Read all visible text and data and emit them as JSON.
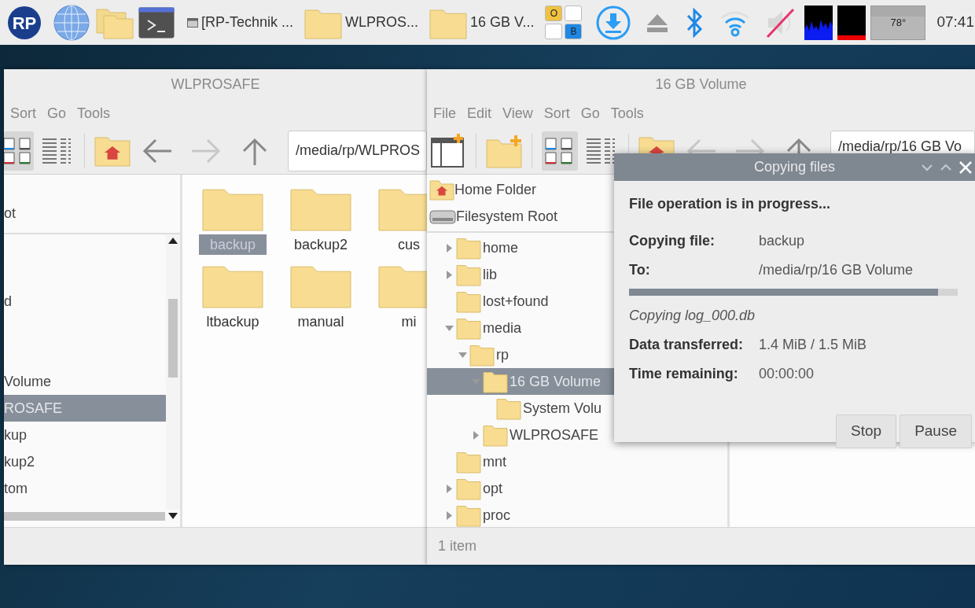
{
  "taskbar": {
    "logo": "RP",
    "tasks": [
      {
        "kind": "window",
        "label": "[RP-Technik ..."
      },
      {
        "kind": "folder",
        "label": "WLPROS..."
      },
      {
        "kind": "folder",
        "label": "16 GB V..."
      }
    ],
    "keyboard": [
      {
        "label": "O",
        "color": "#efc240"
      },
      {
        "label": "B",
        "color": "#1e88e5"
      }
    ],
    "temperature": "78°",
    "clock": "07:41"
  },
  "left_window": {
    "title": "WLPROSAFE",
    "menu": [
      "Sort",
      "Go",
      "Tools"
    ],
    "views": [
      {
        "kind": "icon",
        "selected": true
      },
      {
        "kind": "list",
        "selected": false
      }
    ],
    "nav": [
      {
        "kind": "back",
        "disabled": false
      },
      {
        "kind": "forward",
        "disabled": true
      },
      {
        "kind": "up",
        "disabled": false
      }
    ],
    "path": "/media/rp/WLPROS",
    "places": [
      "ot"
    ],
    "tree": [
      {
        "label": "d",
        "selected": false
      },
      {
        "label": "Volume",
        "selected": false
      },
      {
        "label": "ROSAFE",
        "selected": true
      },
      {
        "label": "kup",
        "selected": false
      },
      {
        "label": "kup2",
        "selected": false
      },
      {
        "label": "tom",
        "selected": false
      }
    ],
    "files": [
      {
        "label": "backup",
        "selected": true
      },
      {
        "label": "backup2",
        "selected": false
      },
      {
        "label": "cus",
        "selected": false
      },
      {
        "label": "ltbackup",
        "selected": false
      },
      {
        "label": "manual",
        "selected": false
      },
      {
        "label": "mi",
        "selected": false
      }
    ]
  },
  "right_window": {
    "title": "16 GB Volume",
    "menu": [
      "File",
      "Edit",
      "View",
      "Sort",
      "Go",
      "Tools"
    ],
    "views": [
      {
        "kind": "icon",
        "selected": true
      },
      {
        "kind": "list",
        "selected": false
      }
    ],
    "nav": [
      {
        "kind": "back",
        "disabled": true
      },
      {
        "kind": "forward",
        "disabled": true
      },
      {
        "kind": "up",
        "disabled": false
      }
    ],
    "path": "/media/rp/16 GB Vo",
    "places": [
      {
        "kind": "home",
        "label": "Home Folder"
      },
      {
        "kind": "drive",
        "label": "Filesystem Root"
      }
    ],
    "tree": [
      {
        "label": "home",
        "expandable": true,
        "expanded": false,
        "selected": false
      },
      {
        "label": "lib",
        "expandable": true,
        "expanded": false,
        "selected": false
      },
      {
        "label": "lost+found",
        "expandable": false,
        "selected": false
      },
      {
        "label": "media",
        "expandable": true,
        "expanded": true,
        "selected": false,
        "children": [
          {
            "label": "rp",
            "expandable": true,
            "expanded": true,
            "selected": false,
            "children": [
              {
                "label": "16 GB Volume",
                "expandable": true,
                "expanded": true,
                "selected": true,
                "children": [
                  {
                    "label": "System Volu",
                    "expandable": false,
                    "selected": false
                  }
                ]
              },
              {
                "label": "WLPROSAFE",
                "expandable": true,
                "expanded": false,
                "selected": false
              }
            ]
          }
        ]
      },
      {
        "label": "mnt",
        "expandable": false,
        "selected": false
      },
      {
        "label": "opt",
        "expandable": true,
        "expanded": false,
        "selected": false
      },
      {
        "label": "proc",
        "expandable": true,
        "expanded": false,
        "selected": false
      }
    ],
    "status": "1 item"
  },
  "dialog": {
    "title": "Copying files",
    "heading": "File operation is in progress...",
    "fields": [
      {
        "label": "Copying file:",
        "value": "backup"
      },
      {
        "label": "To:",
        "value": "/media/rp/16 GB Volume"
      }
    ],
    "progress": {
      "level": 0.94
    },
    "current": "Copying log_000.db",
    "stats": [
      {
        "label": "Data transferred:",
        "value": "1.4 MiB / 1.5 MiB"
      },
      {
        "label": "Time remaining:",
        "value": "00:00:00"
      }
    ],
    "buttons": [
      "Stop",
      "Pause"
    ]
  }
}
